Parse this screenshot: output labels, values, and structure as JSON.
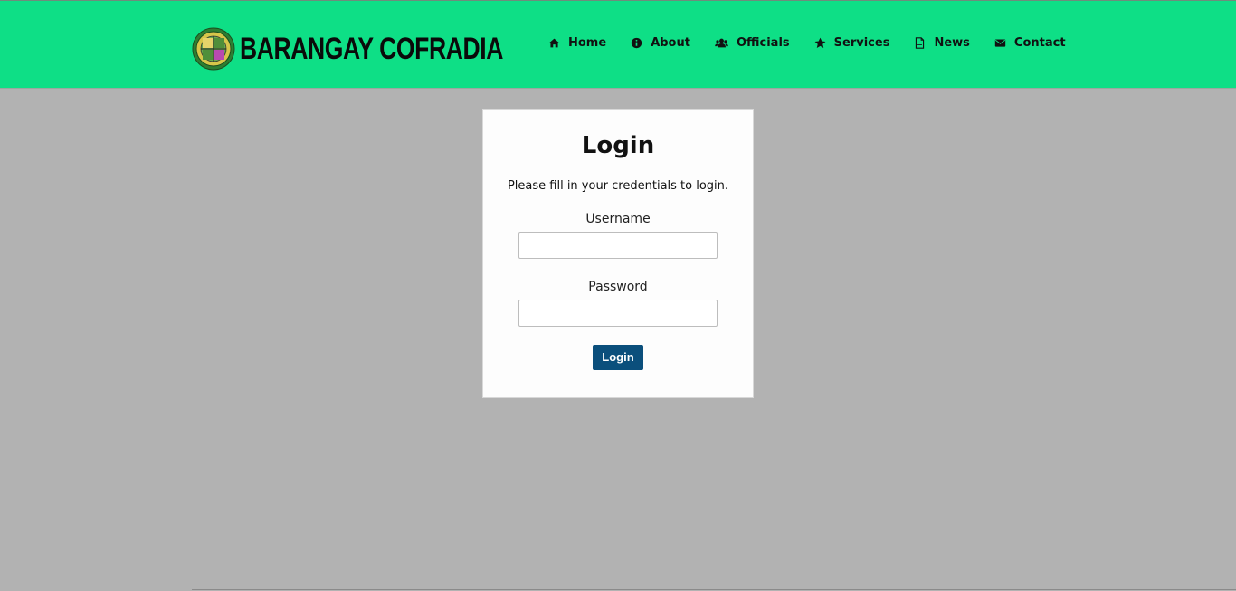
{
  "brand": {
    "name": "BARANGAY COFRADIA",
    "logo_icon": "barangay-seal-icon"
  },
  "nav": {
    "items": [
      {
        "label": "Home",
        "icon": "home-icon"
      },
      {
        "label": "About",
        "icon": "info-circle-icon"
      },
      {
        "label": "Officials",
        "icon": "users-icon"
      },
      {
        "label": "Services",
        "icon": "star-icon"
      },
      {
        "label": "News",
        "icon": "document-icon"
      },
      {
        "label": "Contact",
        "icon": "envelope-icon"
      }
    ]
  },
  "login": {
    "title": "Login",
    "description": "Please fill in your credentials to login.",
    "username_label": "Username",
    "username_value": "",
    "password_label": "Password",
    "password_value": "",
    "submit_label": "Login"
  },
  "colors": {
    "header_bg": "#0edf86",
    "page_bg": "#b2b2b2",
    "card_bg": "#fdfdfd",
    "button_bg": "#0b4f7c"
  }
}
